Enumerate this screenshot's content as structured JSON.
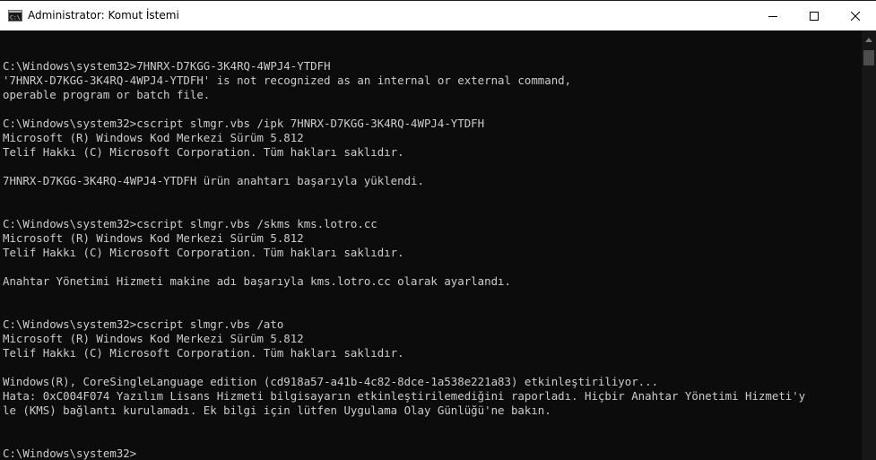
{
  "window": {
    "title": "Administrator: Komut İstemi",
    "icon": "cmd-icon"
  },
  "controls": {
    "minimize_icon": "minimize-icon",
    "maximize_icon": "maximize-icon",
    "close_icon": "close-icon"
  },
  "console": {
    "lines": [
      "",
      "C:\\Windows\\system32>7HNRX-D7KGG-3K4RQ-4WPJ4-YTDFH",
      "'7HNRX-D7KGG-3K4RQ-4WPJ4-YTDFH' is not recognized as an internal or external command,",
      "operable program or batch file.",
      "",
      "C:\\Windows\\system32>cscript slmgr.vbs /ipk 7HNRX-D7KGG-3K4RQ-4WPJ4-YTDFH",
      "Microsoft (R) Windows Kod Merkezi Sürüm 5.812",
      "Telif Hakkı (C) Microsoft Corporation. Tüm hakları saklıdır.",
      "",
      "7HNRX-D7KGG-3K4RQ-4WPJ4-YTDFH ürün anahtarı başarıyla yüklendi.",
      "",
      "",
      "C:\\Windows\\system32>cscript slmgr.vbs /skms kms.lotro.cc",
      "Microsoft (R) Windows Kod Merkezi Sürüm 5.812",
      "Telif Hakkı (C) Microsoft Corporation. Tüm hakları saklıdır.",
      "",
      "Anahtar Yönetimi Hizmeti makine adı başarıyla kms.lotro.cc olarak ayarlandı.",
      "",
      "",
      "C:\\Windows\\system32>cscript slmgr.vbs /ato",
      "Microsoft (R) Windows Kod Merkezi Sürüm 5.812",
      "Telif Hakkı (C) Microsoft Corporation. Tüm hakları saklıdır.",
      "",
      "Windows(R), CoreSingleLanguage edition (cd918a57-a41b-4c82-8dce-1a538e221a83) etkinleştiriliyor...",
      "Hata: 0xC004F074 Yazılım Lisans Hizmeti bilgisayarın etkinleştirilemediğini raporladı. Hiçbir Anahtar Yönetimi Hizmeti'y",
      "le (KMS) bağlantı kurulamadı. Ek bilgi için lütfen Uygulama Olay Günlüğü'ne bakın.",
      "",
      "",
      "C:\\Windows\\system32>"
    ]
  },
  "colors": {
    "background": "#0c0c0c",
    "text": "#cccccc",
    "titlebar": "#ffffff"
  }
}
